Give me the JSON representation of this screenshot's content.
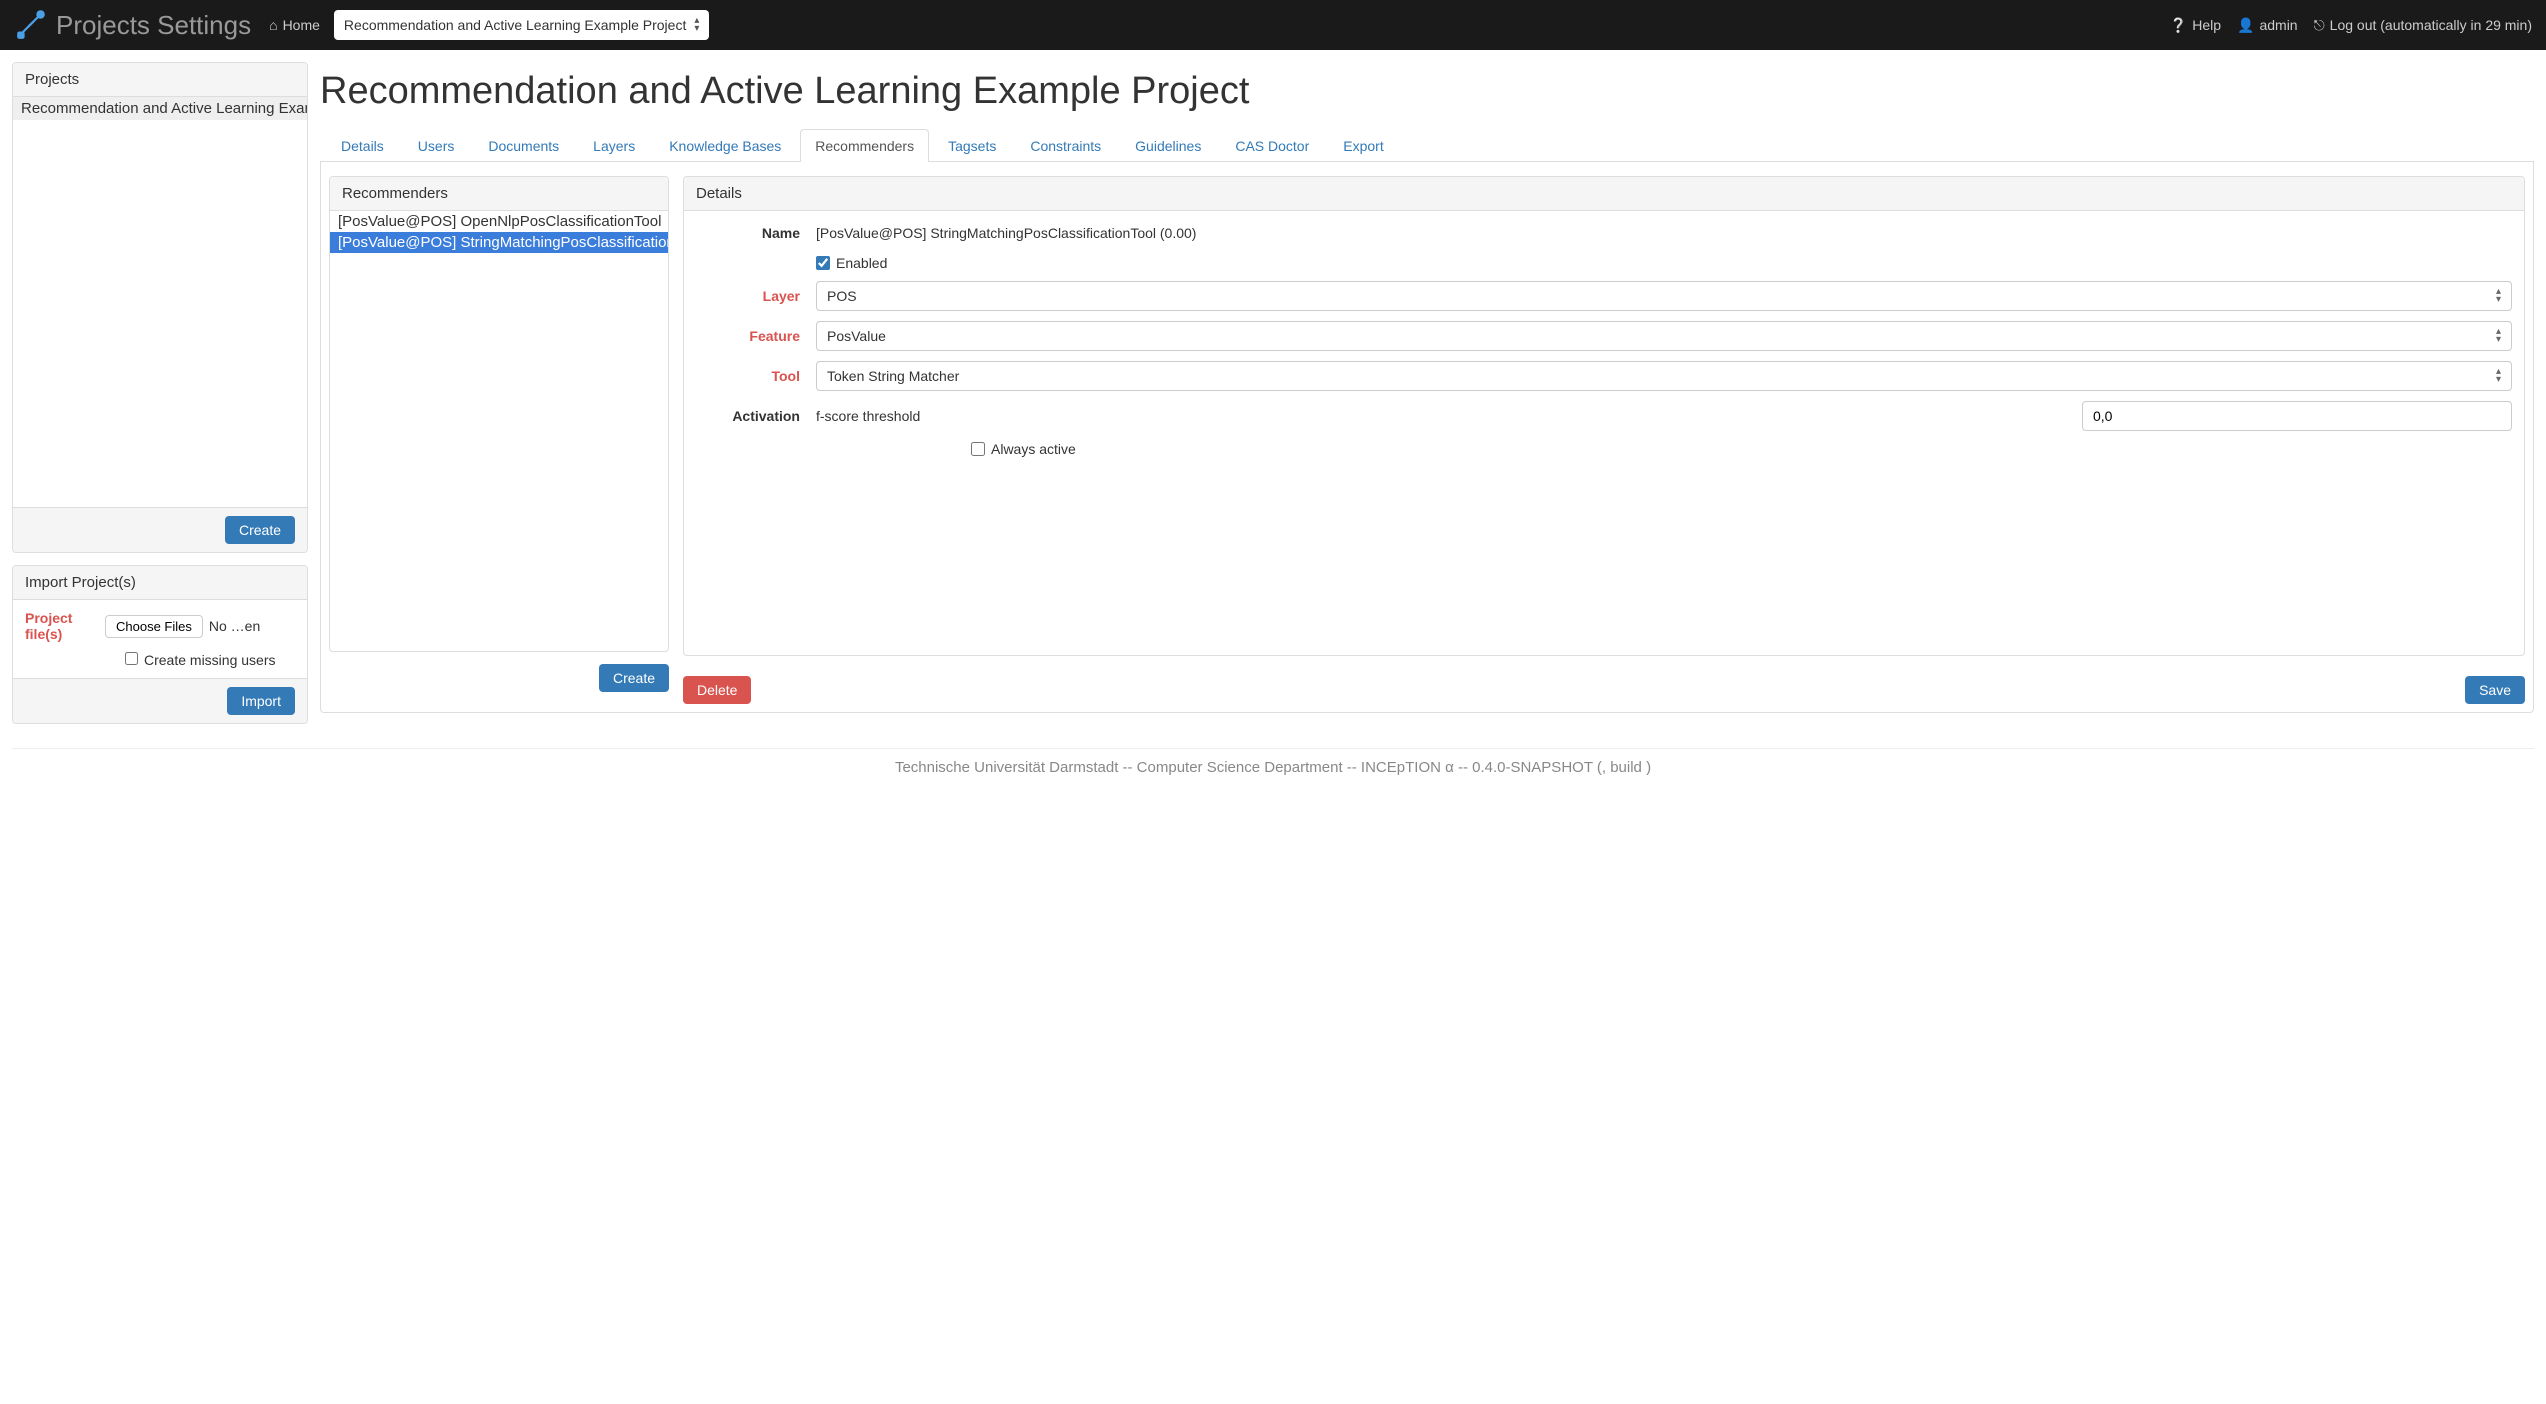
{
  "brand": "Projects Settings",
  "home_label": "Home",
  "project_select_value": "Recommendation and Active Learning Example Project",
  "help_label": "Help",
  "user_label": "admin",
  "logout_label": "Log out (automatically in 29 min)",
  "projects_panel": {
    "title": "Projects",
    "items": [
      "Recommendation and Active Learning Example Project"
    ],
    "create_label": "Create"
  },
  "import_panel": {
    "title": "Import Project(s)",
    "file_label": "Project file(s)",
    "choose_label": "Choose Files",
    "file_status": "No …en",
    "create_missing_label": "Create missing users",
    "import_label": "Import"
  },
  "page_title": "Recommendation and Active Learning Example Project",
  "tabs": [
    "Details",
    "Users",
    "Documents",
    "Layers",
    "Knowledge Bases",
    "Recommenders",
    "Tagsets",
    "Constraints",
    "Guidelines",
    "CAS Doctor",
    "Export"
  ],
  "active_tab": "Recommenders",
  "recommenders_panel": {
    "title": "Recommenders",
    "items": [
      "[PosValue@POS] OpenNlpPosClassificationTool",
      "[PosValue@POS] StringMatchingPosClassificationTool"
    ],
    "selected_index": 1,
    "create_label": "Create"
  },
  "details_panel": {
    "title": "Details",
    "name_label": "Name",
    "name_value": "[PosValue@POS] StringMatchingPosClassificationTool (0.00)",
    "enabled_label": "Enabled",
    "enabled_checked": true,
    "layer_label": "Layer",
    "layer_value": "POS",
    "feature_label": "Feature",
    "feature_value": "PosValue",
    "tool_label": "Tool",
    "tool_value": "Token String Matcher",
    "activation_label": "Activation",
    "threshold_label": "f-score threshold",
    "threshold_value": "0,0",
    "always_active_label": "Always active",
    "delete_label": "Delete",
    "save_label": "Save"
  },
  "footer_text": "Technische Universität Darmstadt -- Computer Science Department -- INCEpTION α -- 0.4.0-SNAPSHOT (, build )"
}
